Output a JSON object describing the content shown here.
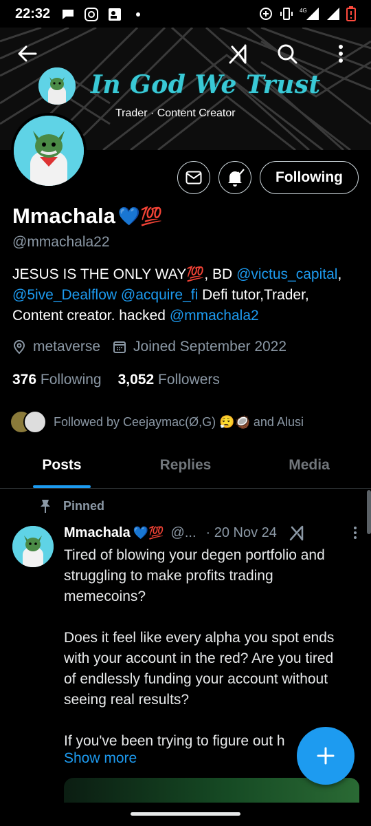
{
  "status_bar": {
    "time": "22:32",
    "network": "4G"
  },
  "header": {
    "banner_title": "In God We Trust",
    "banner_subtitle": "Trader · Content Creator"
  },
  "profile": {
    "name": "Mmachala",
    "name_emoji": "💙💯",
    "handle": "@mmachala22",
    "bio_parts": {
      "p1": "JESUS IS THE ONLY WAY💯,  BD ",
      "link1": "@victus_capital",
      "p2": ",",
      "link2": "@5ive_Dealflow",
      "p3": " ",
      "link3": "@acquire_fi",
      "p4": "  Defi tutor,Trader, Content creator. hacked ",
      "link4": "@mmachala2"
    },
    "location": "metaverse",
    "joined": "Joined September 2022",
    "following_count": "376",
    "following_label": "Following",
    "followers_count": "3,052",
    "followers_label": "Followers",
    "followed_by": "Followed by Ceejaymac(Ø,G) 😮‍💨🥥 and Alusi"
  },
  "actions": {
    "following_button": "Following"
  },
  "tabs": [
    {
      "label": "Posts",
      "active": true
    },
    {
      "label": "Replies",
      "active": false
    },
    {
      "label": "Media",
      "active": false
    }
  ],
  "post": {
    "pinned_label": "Pinned",
    "author": "Mmachala",
    "author_emoji": "💙💯",
    "handle_truncated": "@...",
    "date": "· 20 Nov 24",
    "text": "Tired of blowing your degen portfolio and struggling to make profits trading memecoins?\n\nDoes it feel like every alpha you spot ends with your account in the red? Are you tired of endlessly funding your account without seeing real results?\n\nIf you've been trying to figure out h",
    "show_more": "Show more"
  },
  "colors": {
    "accent": "#1d9bf0",
    "banner_title": "#39c9d6",
    "muted": "#8b98a5"
  }
}
